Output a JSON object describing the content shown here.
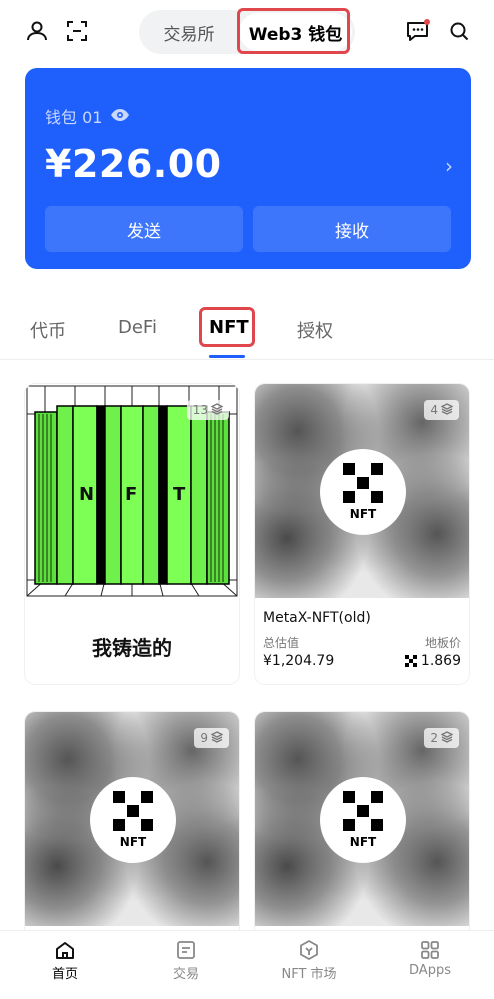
{
  "header": {
    "seg_left": "交易所",
    "seg_right": "Web3 钱包"
  },
  "wallet": {
    "name": "钱包 01",
    "balance": "¥226.00",
    "send_label": "发送",
    "receive_label": "接收",
    "accent": "#1f5ffb"
  },
  "tabs": [
    {
      "label": "代币"
    },
    {
      "label": "DeFi"
    },
    {
      "label": "NFT"
    },
    {
      "label": "授权"
    }
  ],
  "cards": [
    {
      "count": "13",
      "title": "我铸造的",
      "art_letters": [
        "N",
        "F",
        "T"
      ]
    },
    {
      "count": "4",
      "logo_text": "NFT",
      "title": "MetaX-NFT(old)",
      "total_label": "总估值",
      "total_value": "¥1,204.79",
      "floor_label": "地板价",
      "floor_value": "1.869"
    },
    {
      "count": "9",
      "logo_text": "NFT"
    },
    {
      "count": "2",
      "logo_text": "NFT"
    }
  ],
  "bottom_nav": [
    {
      "label": "首页",
      "icon": "home-icon"
    },
    {
      "label": "交易",
      "icon": "trade-icon"
    },
    {
      "label": "NFT 市场",
      "icon": "nft-market-icon"
    },
    {
      "label": "DApps",
      "icon": "dapps-icon"
    }
  ]
}
